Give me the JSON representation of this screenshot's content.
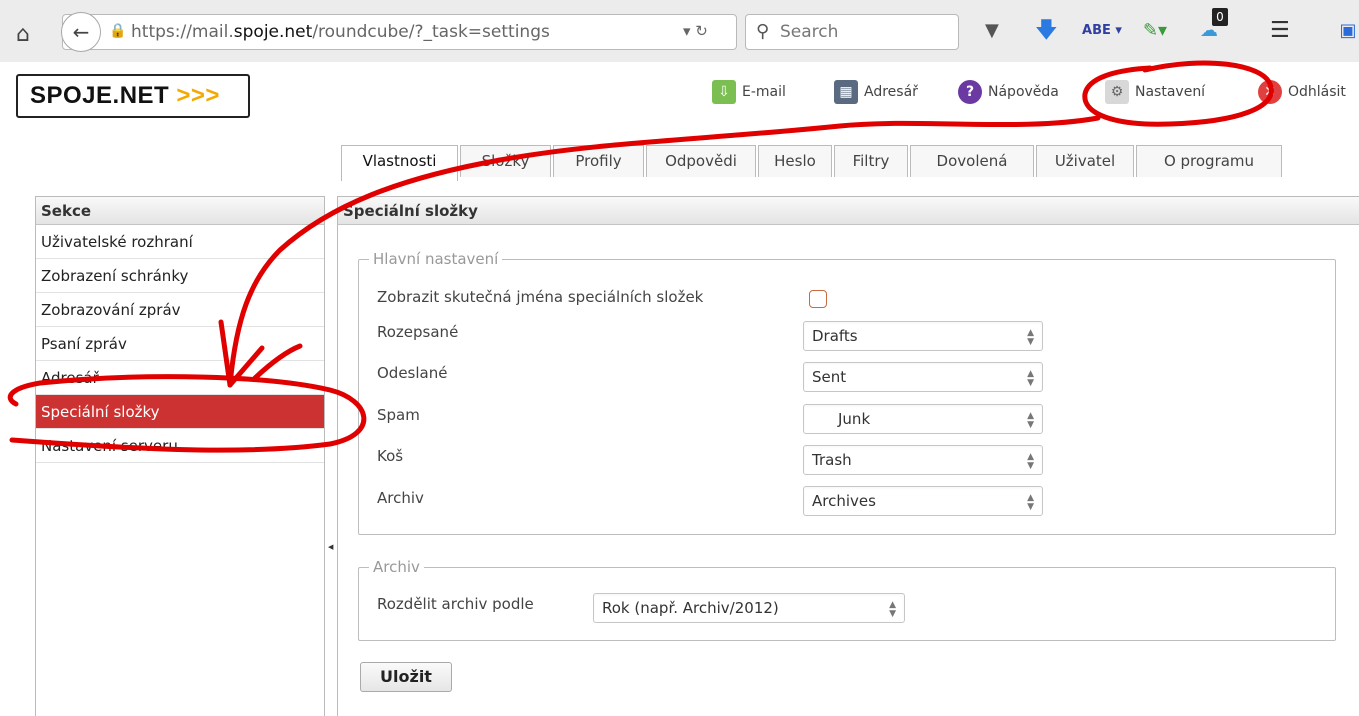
{
  "browser": {
    "url_prefix": "https://mail.",
    "url_domain": "spoje.net",
    "url_suffix": "/roundcube/?_task=settings",
    "search_placeholder": "Search",
    "notification_count": "0"
  },
  "app": {
    "logo_text": "SPOJE.NET",
    "logo_arrows": ">>>",
    "topnav": [
      {
        "label": "E-mail",
        "icon": "mail-download-icon"
      },
      {
        "label": "Adresář",
        "icon": "addressbook-icon"
      },
      {
        "label": "Nápověda",
        "icon": "help-icon"
      },
      {
        "label": "Nastavení",
        "icon": "settings-icon"
      },
      {
        "label": "Odhlásit",
        "icon": "logout-icon"
      }
    ]
  },
  "tabs": [
    "Vlastnosti",
    "Složky",
    "Profily",
    "Odpovědi",
    "Heslo",
    "Filtry",
    "Dovolená",
    "Uživatel",
    "O programu"
  ],
  "sidebar": {
    "header": "Sekce",
    "items": [
      "Uživatelské rozhraní",
      "Zobrazení schránky",
      "Zobrazování zpráv",
      "Psaní zpráv",
      "Adresář",
      "Speciální složky",
      "Nastavení serveru"
    ],
    "selected_index": 5
  },
  "main": {
    "header": "Speciální složky",
    "main_settings": {
      "legend": "Hlavní nastavení",
      "show_real_names_label": "Zobrazit skutečná jména speciálních složek",
      "show_real_names_checked": false,
      "rows": [
        {
          "label": "Rozepsané",
          "value": "Drafts"
        },
        {
          "label": "Odeslané",
          "value": "Sent"
        },
        {
          "label": "Spam",
          "value": "Junk"
        },
        {
          "label": "Koš",
          "value": "Trash"
        },
        {
          "label": "Archiv",
          "value": "Archives"
        }
      ]
    },
    "archive": {
      "legend": "Archiv",
      "split_label": "Rozdělit archiv podle",
      "split_value": "Rok (např. Archiv/2012)"
    },
    "save_label": "Uložit"
  },
  "colors": {
    "selected_item": "#cc3232",
    "annotation": "#e00000",
    "logo_arrows": "#f5a800"
  }
}
